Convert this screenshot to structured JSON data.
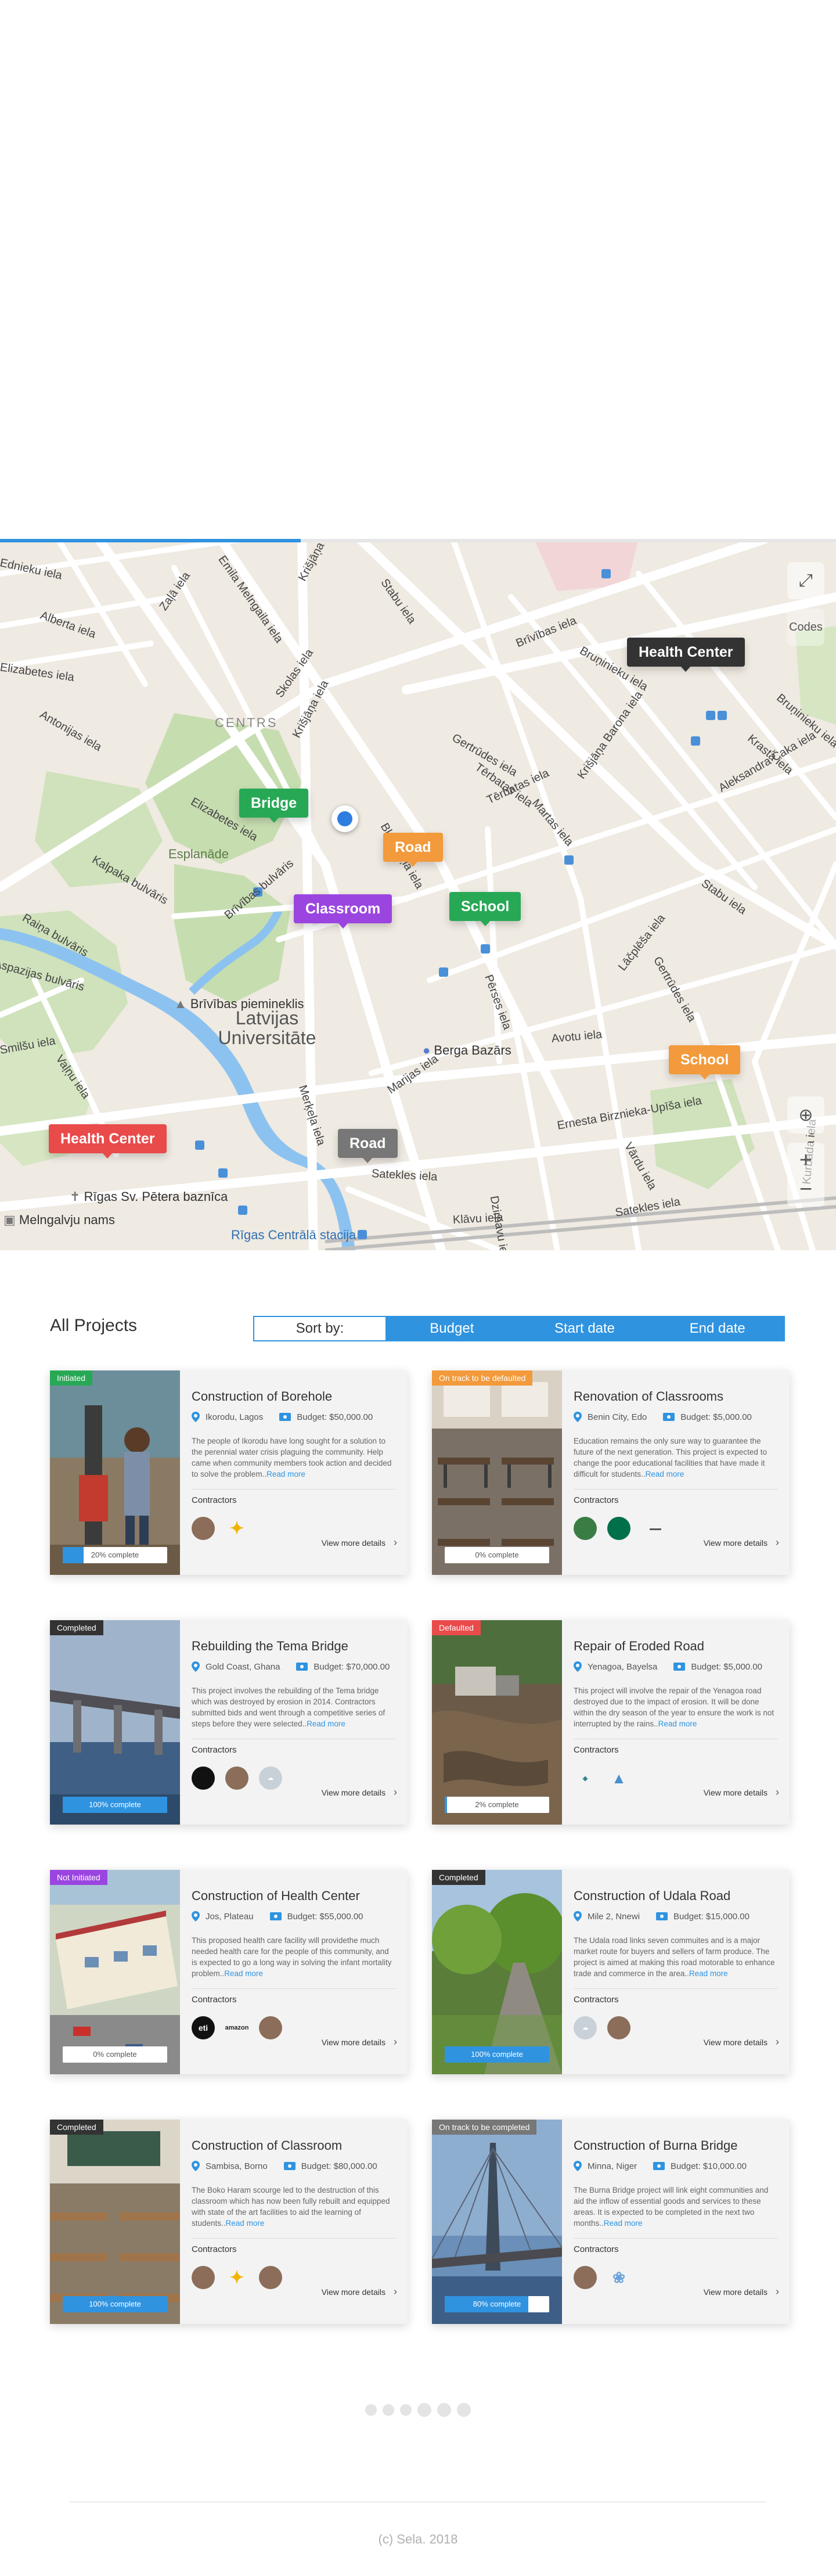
{
  "map": {
    "progress_percent": 36,
    "codes_label": "Codes",
    "controls": {
      "expand_icon": "expand-icon",
      "locate_icon": "locate-icon",
      "zoom_in": "+",
      "zoom_out": "−"
    },
    "streets": [
      "Ednieku iela",
      "Alberta iela",
      "Elizabetes iela",
      "Antonijas iela",
      "Zaļā iela",
      "Emila Melngaila iela",
      "Krišjāņa Valdemāra iela",
      "Stabu iela",
      "Skolas iela",
      "Krišjāņa iela",
      "Bruņinieku iela",
      "Brīvības iela",
      "Tērbatas iela",
      "Gertrūdes iela",
      "Martas iela",
      "Krišjāņa Barona iela",
      "Aleksandra Čaka iela",
      "Tērbatas iela",
      "Raiņa bulvāris",
      "Kalpaka bulvāris",
      "Brīvības bulvāris",
      "Elizabetes iela",
      "Blaumaņa iela",
      "Pērses iela",
      "Lāčplēša iela",
      "Avotu iela",
      "Gertrūdes iela",
      "Marijas iela",
      "Satekles iela",
      "Ernesta Birznieka-Upīša iela",
      "Merķeļa iela",
      "Vaļņu iela",
      "Smilšu iela",
      "Aspazijas bulvāris",
      "Krasta iela",
      "Dzirnavu iela",
      "Klāvu iela",
      "Satekles iela",
      "Vārdu iela",
      "Kurbada iela",
      "Bruņinieku iela",
      "Stabu iela"
    ],
    "areas": [
      "CENTRS",
      "Esplanāde",
      "Latvijas Universitāte"
    ],
    "pois": [
      "Brīvības piemineklis",
      "Berga Bazārs",
      "Rīgas Sv. Pētera baznīca",
      "Rīgas Centrālā stacija",
      "Melngalvju nams"
    ],
    "pins": [
      {
        "label": "Health Center",
        "color": "#333333"
      },
      {
        "label": "Bridge",
        "color": "#27a855"
      },
      {
        "label": "Road",
        "color": "#f29a3c"
      },
      {
        "label": "Classroom",
        "color": "#9b45e0"
      },
      {
        "label": "School",
        "color": "#27a855"
      },
      {
        "label": "School",
        "color": "#f29a3c"
      },
      {
        "label": "Health Center",
        "color": "#e94a4a"
      },
      {
        "label": "Road",
        "color": "#777777"
      }
    ]
  },
  "projects": {
    "title": "All Projects",
    "sort_label": "Sort by:",
    "sort_options": [
      "Budget",
      "Start date",
      "End date"
    ],
    "contractors_label": "Contractors",
    "view_more": "View more details",
    "read_more": "Read more",
    "cards": [
      {
        "status": "Initiated",
        "status_color": "#27a855",
        "title": "Construction of Borehole",
        "location": "Ikorodu, Lagos",
        "budget": "Budget: $50,000.00",
        "description": "The people of Ikorodu have long sought for a solution to the perennial water crisis plaguing the community. Help came when community members took action and decided to solve the problem..",
        "progress": 20,
        "progress_text": "20% complete",
        "contractors": [
          "person-avatar",
          "sela-logo"
        ]
      },
      {
        "status": "On track to be defaulted",
        "status_color": "#f29a3c",
        "title": "Renovation of Classrooms",
        "location": "Benin City, Edo",
        "budget": "Budget: $5,000.00",
        "description": "Education remains the only sure way to guarantee the future of the next generation. This project is expected to change the poor educational facilities that have made it difficult for students..",
        "progress": 0,
        "progress_text": "0% complete",
        "contractors": [
          "green-logo",
          "starbucks-logo",
          "firm-logo"
        ]
      },
      {
        "status": "Completed",
        "status_color": "#333333",
        "title": "Rebuilding the Tema Bridge",
        "location": "Gold Coast, Ghana",
        "budget": "Budget: $70,000.00",
        "description": "This project involves the rebuilding of the Tema bridge which was destroyed by erosion in 2014. Contractors submitted bids and went through a competitive series of steps before they were selected..",
        "progress": 100,
        "progress_text": "100% complete",
        "contractors": [
          "black-logo",
          "person-avatar",
          "salesforce-logo"
        ]
      },
      {
        "status": "Defaulted",
        "status_color": "#e94a4a",
        "title": "Repair of Eroded Road",
        "location": "Yenagoa, Bayelsa",
        "budget": "Budget: $5,000.00",
        "description": "This project will involve the repair of the Yenagoa road destroyed due to the impact of erosion. It will be done within the dry season of the year to ensure the work is not interrupted by the rains..",
        "progress": 2,
        "progress_text": "2% complete",
        "contractors": [
          "company-logo",
          "mountain-logo"
        ]
      },
      {
        "status": "Not Initiated",
        "status_color": "#9b45e0",
        "title": "Construction of Health Center",
        "location": "Jos, Plateau",
        "budget": "Budget: $55,000.00",
        "description": "This proposed health care facility will providethe much needed health care for the people of this community, and is expected to go a long way in solving the infant mortality problem..",
        "progress": 0,
        "progress_text": "0% complete",
        "contractors": [
          "eti-logo",
          "amazon-logo",
          "person-avatar"
        ]
      },
      {
        "status": "Completed",
        "status_color": "#333333",
        "title": "Construction of Udala Road",
        "location": "Mile 2, Nnewi",
        "budget": "Budget: $15,000.00",
        "description": "The Udala road links seven commuites and is a major market route for buyers and sellers of farm produce. The project is aimed at making this road motorable to enhance trade and commerce in the area..",
        "progress": 100,
        "progress_text": "100% complete",
        "contractors": [
          "salesforce-logo",
          "person-avatar"
        ]
      },
      {
        "status": "Completed",
        "status_color": "#333333",
        "title": "Construction of Classroom",
        "location": "Sambisa, Borno",
        "budget": "Budget: $80,000.00",
        "description": "The Boko Haram scourge led to the destruction of this classroom which has now been fully rebuilt and equipped with state of the art facilities to aid the learning of students..",
        "progress": 100,
        "progress_text": "100% complete",
        "contractors": [
          "person-avatar",
          "sela-logo",
          "person-avatar"
        ]
      },
      {
        "status": "On track to be completed",
        "status_color": "#777777",
        "title": "Construction of Burna Bridge",
        "location": "Minna, Niger",
        "budget": "Budget: $10,000.00",
        "description": "The Burna Bridge project will link eight communities and aid the inflow of essential goods and services to these areas. It is expected to be completed in the next two months..",
        "progress": 80,
        "progress_text": "80% complete",
        "contractors": [
          "person-avatar",
          "baby-logo"
        ]
      }
    ]
  },
  "pagination": {
    "pages": 6
  },
  "footer": {
    "text": "(c) Sela. 2018"
  }
}
